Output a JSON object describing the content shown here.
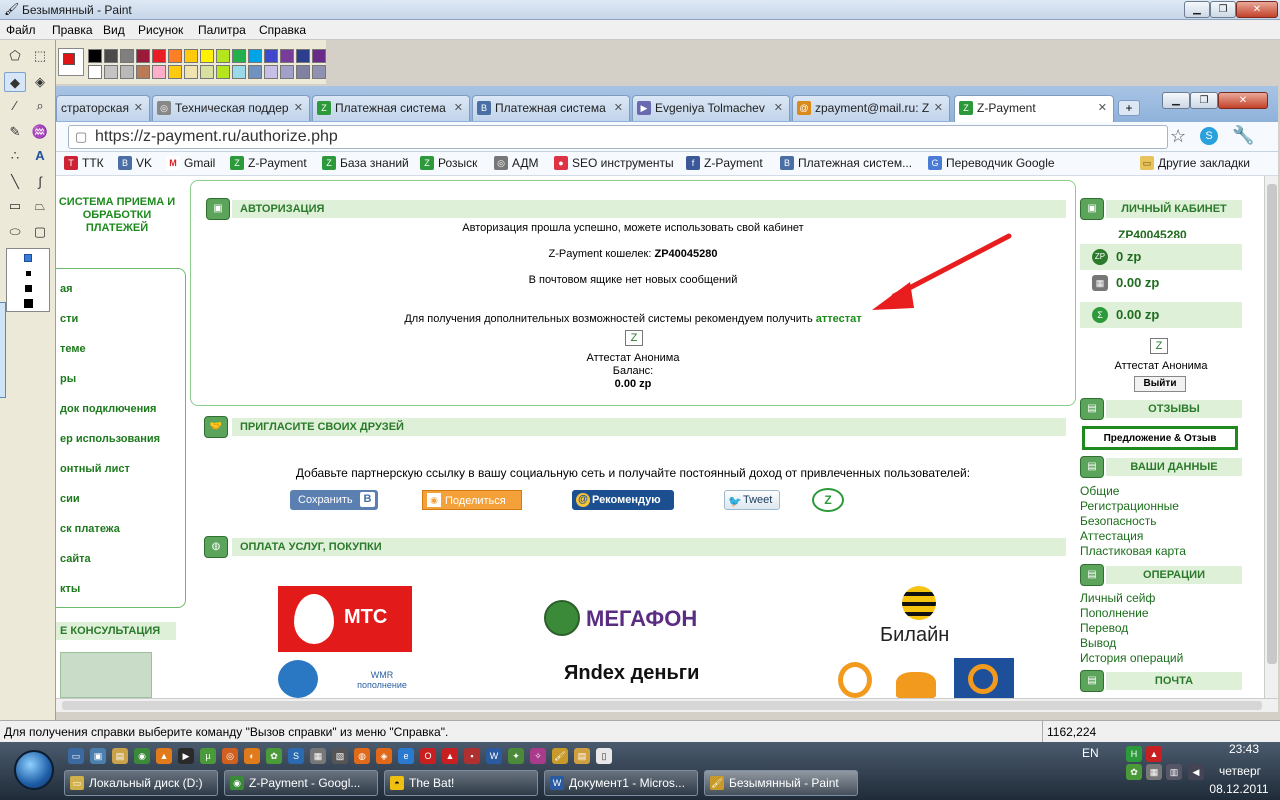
{
  "paint": {
    "title": "Безымянный - Paint",
    "menu": [
      "Файл",
      "Правка",
      "Вид",
      "Рисунок",
      "Палитра",
      "Справка"
    ],
    "status_text": "Для получения справки выберите команду \"Вызов справки\" из меню \"Справка\".",
    "coords": "1162,224"
  },
  "browser": {
    "tabs": [
      "страторская",
      "Техническая поддер",
      "Платежная система",
      "Платежная система",
      "Evgeniya Tolmachev",
      "zpayment@mail.ru: Z",
      "Z-Payment"
    ],
    "url": "https://z-payment.ru/authorize.php",
    "bookmarks": [
      "ТТК",
      "VK",
      "Gmail",
      "Z-Payment",
      "База знаний",
      "Розыск",
      "АДМ",
      "SEO инструменты",
      "Z-Payment",
      "Платежная систем...",
      "Переводчик Google"
    ],
    "other_bookmarks": "Другие закладки"
  },
  "page": {
    "logo_text": "СИСТЕМА ПРИЕМА И ОБРАБОТКИ ПЛАТЕЖЕЙ",
    "left_nav": [
      "ая",
      "сти",
      "теме",
      "ры",
      "док подключения",
      "ер использования",
      "онтный лист",
      "сии",
      "ск платежа",
      "сайта",
      "кты"
    ],
    "consult_label": "Е КОНСУЛЬТАЦИЯ",
    "auth": {
      "title": "АВТОРИЗАЦИЯ",
      "success": "Авторизация прошла успешно, можете использовать свой кабинет",
      "wallet_label": "Z-Payment кошелек:",
      "wallet_value": "ZP40045280",
      "no_messages": "В почтовом ящике нет новых сообщений",
      "recommend": "Для получения дополнительных возможностей системы рекомендуем получить",
      "attestat_link": "аттестат",
      "attestat_name": "Аттестат Анонима",
      "balance_label": "Баланс:",
      "balance_value": "0.00 zp"
    },
    "invite": {
      "title": "ПРИГЛАСИТЕ СВОИХ ДРУЗЕЙ",
      "text": "Добавьте партнерскую ссылку в вашу социальную сеть и получайте постоянный доход от привлеченных пользователей:",
      "buttons": [
        "Сохранить",
        "Поделиться",
        "Рекомендую",
        "Tweet"
      ]
    },
    "payments": {
      "title": "ОПЛАТА УСЛУГ, ПОКУПКИ",
      "logos": [
        "МТС",
        "МЕГАФОН",
        "Билайн",
        "WMR пополнение",
        "Яndex деньги"
      ]
    },
    "sidebar": {
      "cabinet_title": "ЛИЧНЫЙ КАБИНЕТ",
      "wallet_id": "ZP40045280",
      "balances": [
        "0 zp",
        "0.00 zp",
        "0.00 zp"
      ],
      "attestat_name": "Аттестат Анонима",
      "logout": "Выйти",
      "reviews_title": "ОТЗЫВЫ",
      "reviews_button": "Предложение & Отзыв",
      "data_title": "ВАШИ ДАННЫЕ",
      "data_links": [
        "Общие",
        "Регистрационные",
        "Безопасность",
        "Аттестация",
        "Пластиковая карта"
      ],
      "ops_title": "ОПЕРАЦИИ",
      "ops_links": [
        "Личный сейф",
        "Пополнение",
        "Перевод",
        "Вывод",
        "История операций"
      ],
      "mail_title": "ПОЧТА"
    }
  },
  "taskbar": {
    "tasks": [
      "Локальный диск (D:)",
      "Z-Payment - Googl...",
      "The Bat!",
      "Документ1 - Micros...",
      "Безымянный - Paint"
    ],
    "lang": "EN",
    "time": "23:43",
    "day": "четверг",
    "date": "08.12.2011"
  }
}
